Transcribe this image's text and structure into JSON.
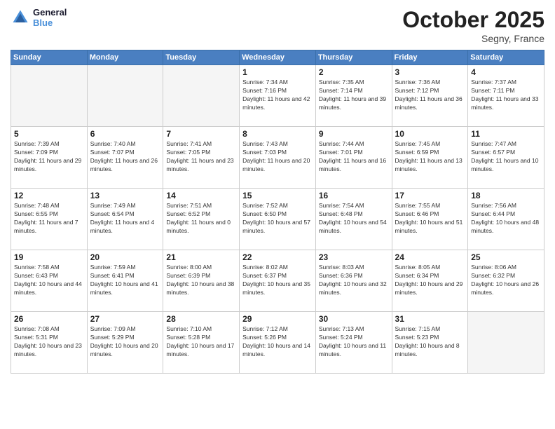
{
  "logo": {
    "text_general": "General",
    "text_blue": "Blue"
  },
  "header": {
    "month": "October 2025",
    "location": "Segny, France"
  },
  "weekdays": [
    "Sunday",
    "Monday",
    "Tuesday",
    "Wednesday",
    "Thursday",
    "Friday",
    "Saturday"
  ],
  "weeks": [
    [
      {
        "day": "",
        "empty": true
      },
      {
        "day": "",
        "empty": true
      },
      {
        "day": "",
        "empty": true
      },
      {
        "day": "1",
        "sunrise": "7:34 AM",
        "sunset": "7:16 PM",
        "daylight": "11 hours and 42 minutes."
      },
      {
        "day": "2",
        "sunrise": "7:35 AM",
        "sunset": "7:14 PM",
        "daylight": "11 hours and 39 minutes."
      },
      {
        "day": "3",
        "sunrise": "7:36 AM",
        "sunset": "7:12 PM",
        "daylight": "11 hours and 36 minutes."
      },
      {
        "day": "4",
        "sunrise": "7:37 AM",
        "sunset": "7:11 PM",
        "daylight": "11 hours and 33 minutes."
      }
    ],
    [
      {
        "day": "5",
        "sunrise": "7:39 AM",
        "sunset": "7:09 PM",
        "daylight": "11 hours and 29 minutes."
      },
      {
        "day": "6",
        "sunrise": "7:40 AM",
        "sunset": "7:07 PM",
        "daylight": "11 hours and 26 minutes."
      },
      {
        "day": "7",
        "sunrise": "7:41 AM",
        "sunset": "7:05 PM",
        "daylight": "11 hours and 23 minutes."
      },
      {
        "day": "8",
        "sunrise": "7:43 AM",
        "sunset": "7:03 PM",
        "daylight": "11 hours and 20 minutes."
      },
      {
        "day": "9",
        "sunrise": "7:44 AM",
        "sunset": "7:01 PM",
        "daylight": "11 hours and 16 minutes."
      },
      {
        "day": "10",
        "sunrise": "7:45 AM",
        "sunset": "6:59 PM",
        "daylight": "11 hours and 13 minutes."
      },
      {
        "day": "11",
        "sunrise": "7:47 AM",
        "sunset": "6:57 PM",
        "daylight": "11 hours and 10 minutes."
      }
    ],
    [
      {
        "day": "12",
        "sunrise": "7:48 AM",
        "sunset": "6:55 PM",
        "daylight": "11 hours and 7 minutes."
      },
      {
        "day": "13",
        "sunrise": "7:49 AM",
        "sunset": "6:54 PM",
        "daylight": "11 hours and 4 minutes."
      },
      {
        "day": "14",
        "sunrise": "7:51 AM",
        "sunset": "6:52 PM",
        "daylight": "11 hours and 0 minutes."
      },
      {
        "day": "15",
        "sunrise": "7:52 AM",
        "sunset": "6:50 PM",
        "daylight": "10 hours and 57 minutes."
      },
      {
        "day": "16",
        "sunrise": "7:54 AM",
        "sunset": "6:48 PM",
        "daylight": "10 hours and 54 minutes."
      },
      {
        "day": "17",
        "sunrise": "7:55 AM",
        "sunset": "6:46 PM",
        "daylight": "10 hours and 51 minutes."
      },
      {
        "day": "18",
        "sunrise": "7:56 AM",
        "sunset": "6:44 PM",
        "daylight": "10 hours and 48 minutes."
      }
    ],
    [
      {
        "day": "19",
        "sunrise": "7:58 AM",
        "sunset": "6:43 PM",
        "daylight": "10 hours and 44 minutes."
      },
      {
        "day": "20",
        "sunrise": "7:59 AM",
        "sunset": "6:41 PM",
        "daylight": "10 hours and 41 minutes."
      },
      {
        "day": "21",
        "sunrise": "8:00 AM",
        "sunset": "6:39 PM",
        "daylight": "10 hours and 38 minutes."
      },
      {
        "day": "22",
        "sunrise": "8:02 AM",
        "sunset": "6:37 PM",
        "daylight": "10 hours and 35 minutes."
      },
      {
        "day": "23",
        "sunrise": "8:03 AM",
        "sunset": "6:36 PM",
        "daylight": "10 hours and 32 minutes."
      },
      {
        "day": "24",
        "sunrise": "8:05 AM",
        "sunset": "6:34 PM",
        "daylight": "10 hours and 29 minutes."
      },
      {
        "day": "25",
        "sunrise": "8:06 AM",
        "sunset": "6:32 PM",
        "daylight": "10 hours and 26 minutes."
      }
    ],
    [
      {
        "day": "26",
        "sunrise": "7:08 AM",
        "sunset": "5:31 PM",
        "daylight": "10 hours and 23 minutes."
      },
      {
        "day": "27",
        "sunrise": "7:09 AM",
        "sunset": "5:29 PM",
        "daylight": "10 hours and 20 minutes."
      },
      {
        "day": "28",
        "sunrise": "7:10 AM",
        "sunset": "5:28 PM",
        "daylight": "10 hours and 17 minutes."
      },
      {
        "day": "29",
        "sunrise": "7:12 AM",
        "sunset": "5:26 PM",
        "daylight": "10 hours and 14 minutes."
      },
      {
        "day": "30",
        "sunrise": "7:13 AM",
        "sunset": "5:24 PM",
        "daylight": "10 hours and 11 minutes."
      },
      {
        "day": "31",
        "sunrise": "7:15 AM",
        "sunset": "5:23 PM",
        "daylight": "10 hours and 8 minutes."
      },
      {
        "day": "",
        "empty": true
      }
    ]
  ]
}
